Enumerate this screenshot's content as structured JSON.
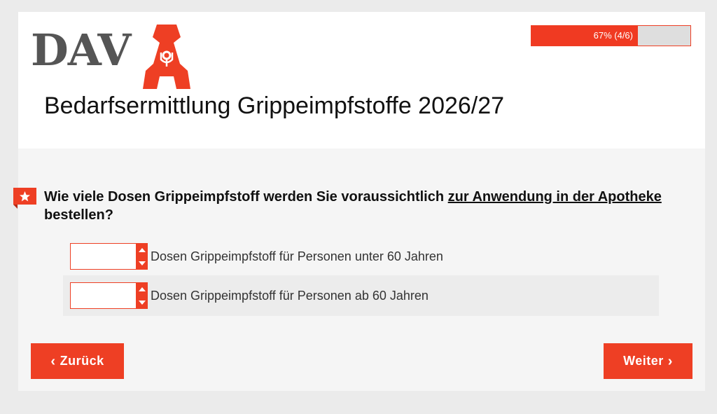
{
  "logo": {
    "text": "DAV"
  },
  "progress": {
    "label": "67% (4/6)",
    "percent": 67
  },
  "survey": {
    "title": "Bedarfsermittlung Grippeimpfstoffe 2026/27"
  },
  "question": {
    "text_before": "Wie viele Dosen Grippeimpfstoff werden Sie voraussichtlich ",
    "text_underlined": "zur Anwendung in der Apotheke",
    "text_after": " bestellen?",
    "rows": [
      {
        "label": "Dosen Grippeimpfstoff für Personen unter 60 Jahren",
        "value": ""
      },
      {
        "label": "Dosen Grippeimpfstoff für Personen ab 60 Jahren",
        "value": ""
      }
    ]
  },
  "nav": {
    "back_label": "Zurück",
    "next_label": "Weiter"
  },
  "icons": {
    "star": "star-icon",
    "chevron_left": "chevron-left-icon",
    "chevron_right": "chevron-right-icon",
    "spin_up": "arrow-up-icon",
    "spin_down": "arrow-down-icon",
    "apotheke_logo": "apotheke-a-logo"
  },
  "colors": {
    "accent": "#ee3f24",
    "logo_gray": "#555555",
    "panel": "#f5f5f5"
  }
}
